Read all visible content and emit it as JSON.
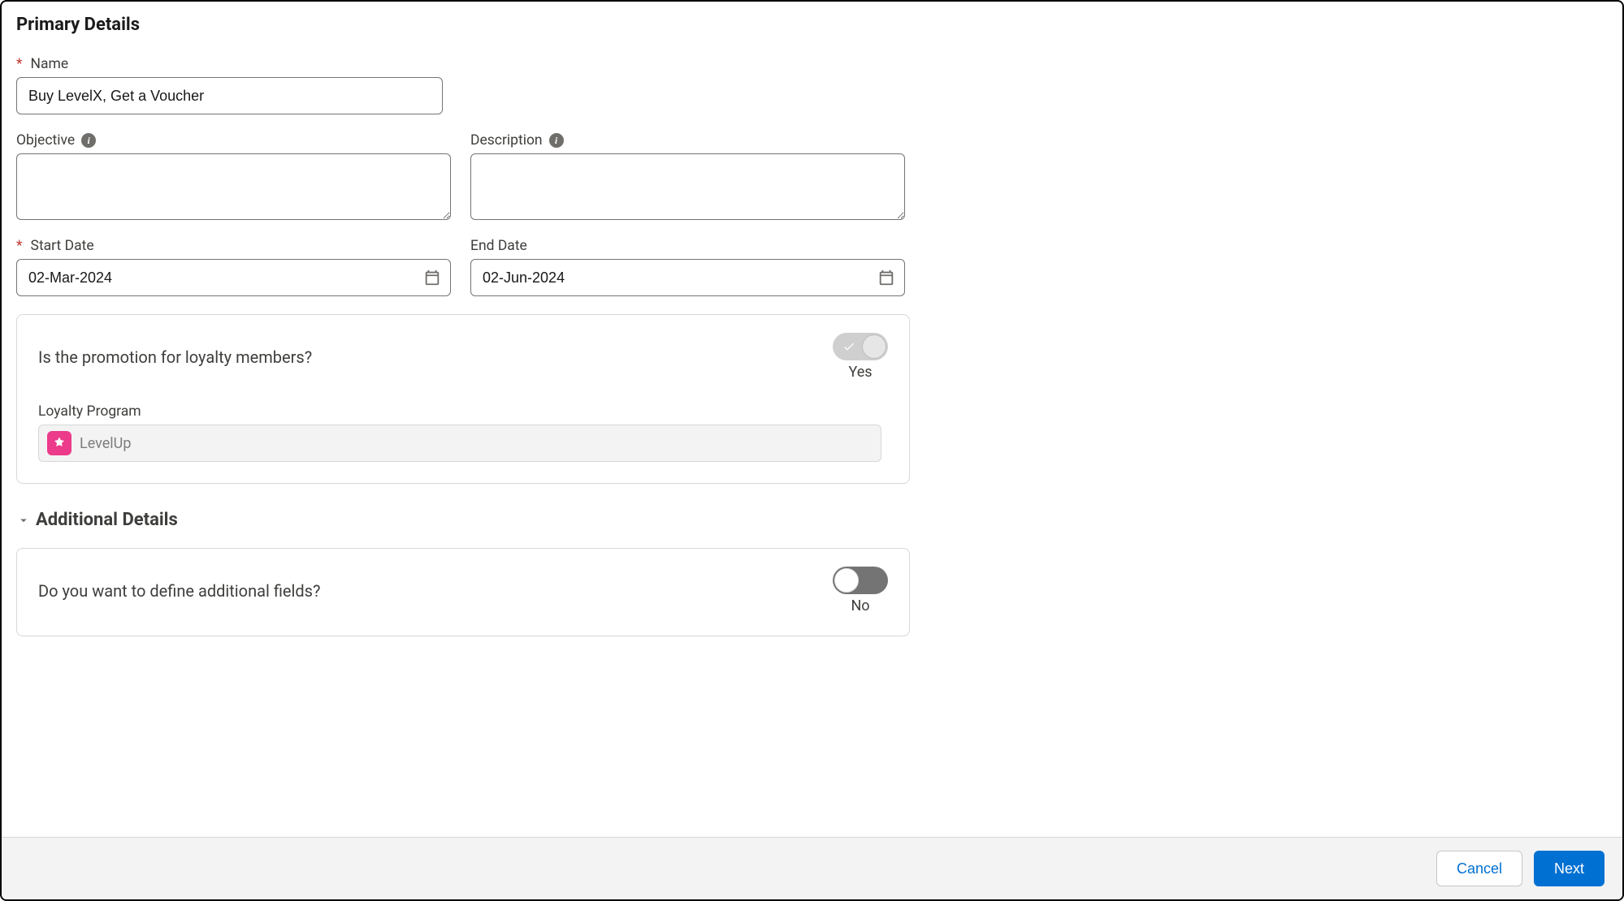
{
  "sections": {
    "primary_title": "Primary Details",
    "additional_title": "Additional Details"
  },
  "fields": {
    "name": {
      "label": "Name",
      "required": true,
      "value": "Buy LevelX, Get a Voucher"
    },
    "objective": {
      "label": "Objective",
      "value": ""
    },
    "description": {
      "label": "Description",
      "value": ""
    },
    "start_date": {
      "label": "Start Date",
      "required": true,
      "value": "02-Mar-2024"
    },
    "end_date": {
      "label": "End Date",
      "value": "02-Jun-2024"
    }
  },
  "loyalty_card": {
    "question": "Is the promotion for loyalty members?",
    "toggle_state": "Yes",
    "loyalty_program_label": "Loyalty Program",
    "loyalty_program_value": "LevelUp"
  },
  "additional_card": {
    "question": "Do you want to define additional fields?",
    "toggle_state": "No"
  },
  "footer": {
    "cancel": "Cancel",
    "next": "Next"
  }
}
